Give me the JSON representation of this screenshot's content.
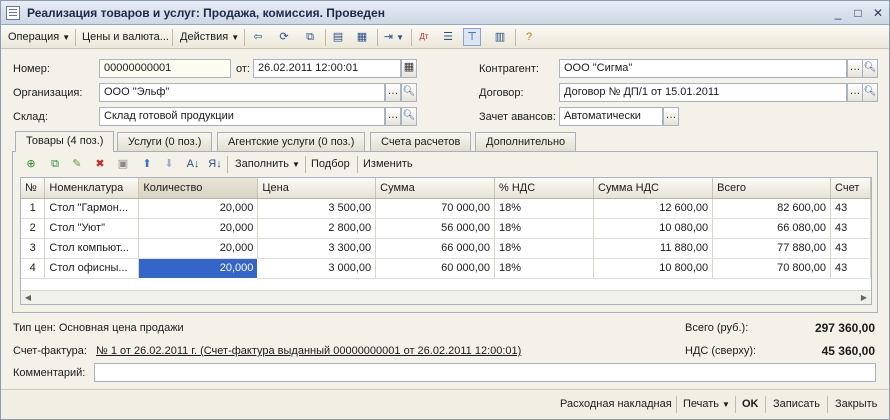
{
  "window": {
    "title": "Реализация товаров и услуг: Продажа, комиссия. Проведен",
    "controls": [
      "_",
      "□",
      "✕"
    ]
  },
  "toolbar": {
    "operation": "Операция",
    "prices": "Цены и валюта...",
    "actions": "Действия"
  },
  "header": {
    "number_label": "Номер:",
    "number_value": "00000000001",
    "date_label": "от:",
    "date_value": "26.02.2011 12:00:01",
    "org_label": "Организация:",
    "org_value": "ООО \"Эльф\"",
    "warehouse_label": "Склад:",
    "warehouse_value": "Склад готовой продукции",
    "counterparty_label": "Контрагент:",
    "counterparty_value": "ООО \"Сигма\"",
    "contract_label": "Договор:",
    "contract_value": "Договор № ДП/1 от 15.01.2011",
    "advance_label": "Зачет авансов:",
    "advance_value": "Автоматически"
  },
  "tabs": [
    {
      "label": "Товары (4 поз.)"
    },
    {
      "label": "Услуги (0 поз.)"
    },
    {
      "label": "Агентские услуги (0 поз.)"
    },
    {
      "label": "Счета расчетов"
    },
    {
      "label": "Дополнительно"
    }
  ],
  "panel_toolbar": {
    "fill": "Заполнить",
    "pick": "Подбор",
    "change": "Изменить"
  },
  "table": {
    "columns": [
      "№",
      "Номенклатура",
      "Количество",
      "Цена",
      "Сумма",
      "% НДС",
      "Сумма НДС",
      "Всего",
      "Счет"
    ],
    "rows": [
      [
        "1",
        "Стол \"Гармон...",
        "20,000",
        "3 500,00",
        "70 000,00",
        "18%",
        "12 600,00",
        "82 600,00",
        "43"
      ],
      [
        "2",
        "Стол \"Уют\"",
        "20,000",
        "2 800,00",
        "56 000,00",
        "18%",
        "10 080,00",
        "66 080,00",
        "43"
      ],
      [
        "3",
        "Стол компьют...",
        "20,000",
        "3 300,00",
        "66 000,00",
        "18%",
        "11 880,00",
        "77 880,00",
        "43"
      ],
      [
        "4",
        "Стол офисны...",
        "20,000",
        "3 000,00",
        "60 000,00",
        "18%",
        "10 800,00",
        "70 800,00",
        "43"
      ]
    ]
  },
  "footer": {
    "price_type": "Тип цен: Основная цена продажи",
    "total_label": "Всего (руб.):",
    "total_value": "297 360,00",
    "invoice_label": "Счет-фактура:",
    "invoice_link": "№ 1 от 26.02.2011 г. (Счет-фактура выданный 00000000001 от 26.02.2011 12:00:01)",
    "vat_label": "НДС (сверху):",
    "vat_value": "45 360,00",
    "comment_label": "Комментарий:",
    "comment_value": ""
  },
  "bottom_bar": {
    "waybill": "Расходная накладная",
    "print": "Печать",
    "ok": "OK",
    "save": "Записать",
    "close": "Закрыть"
  }
}
